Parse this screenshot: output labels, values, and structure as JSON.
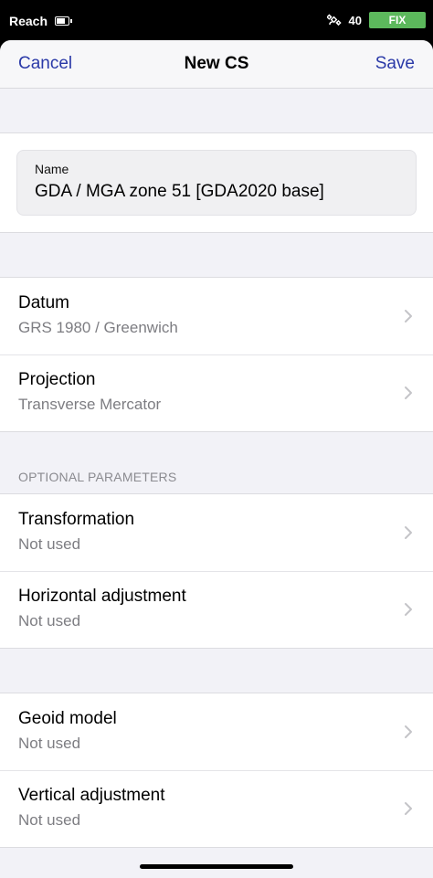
{
  "status_bar": {
    "carrier": "Reach",
    "satellites": "40",
    "fix": "FIX",
    "icons": [
      "battery-icon",
      "satellite-icon"
    ]
  },
  "nav": {
    "cancel": "Cancel",
    "title": "New CS",
    "save": "Save"
  },
  "name_field": {
    "label": "Name",
    "value": "GDA / MGA zone 51 [GDA2020 base]"
  },
  "rows_main": [
    {
      "title": "Datum",
      "subtitle": "GRS 1980 / Greenwich"
    },
    {
      "title": "Projection",
      "subtitle": "Transverse Mercator"
    }
  ],
  "optional_header": "OPTIONAL PARAMETERS",
  "rows_optional": [
    {
      "title": "Transformation",
      "subtitle": "Not used"
    },
    {
      "title": "Horizontal adjustment",
      "subtitle": "Not used"
    }
  ],
  "rows_vertical": [
    {
      "title": "Geoid model",
      "subtitle": "Not used"
    },
    {
      "title": "Vertical adjustment",
      "subtitle": "Not used"
    }
  ],
  "colors": {
    "accent": "#2b3aa8",
    "fix_badge": "#5cb85c",
    "secondary_text": "#7d7d82",
    "grouped_background": "#f2f2f7"
  }
}
